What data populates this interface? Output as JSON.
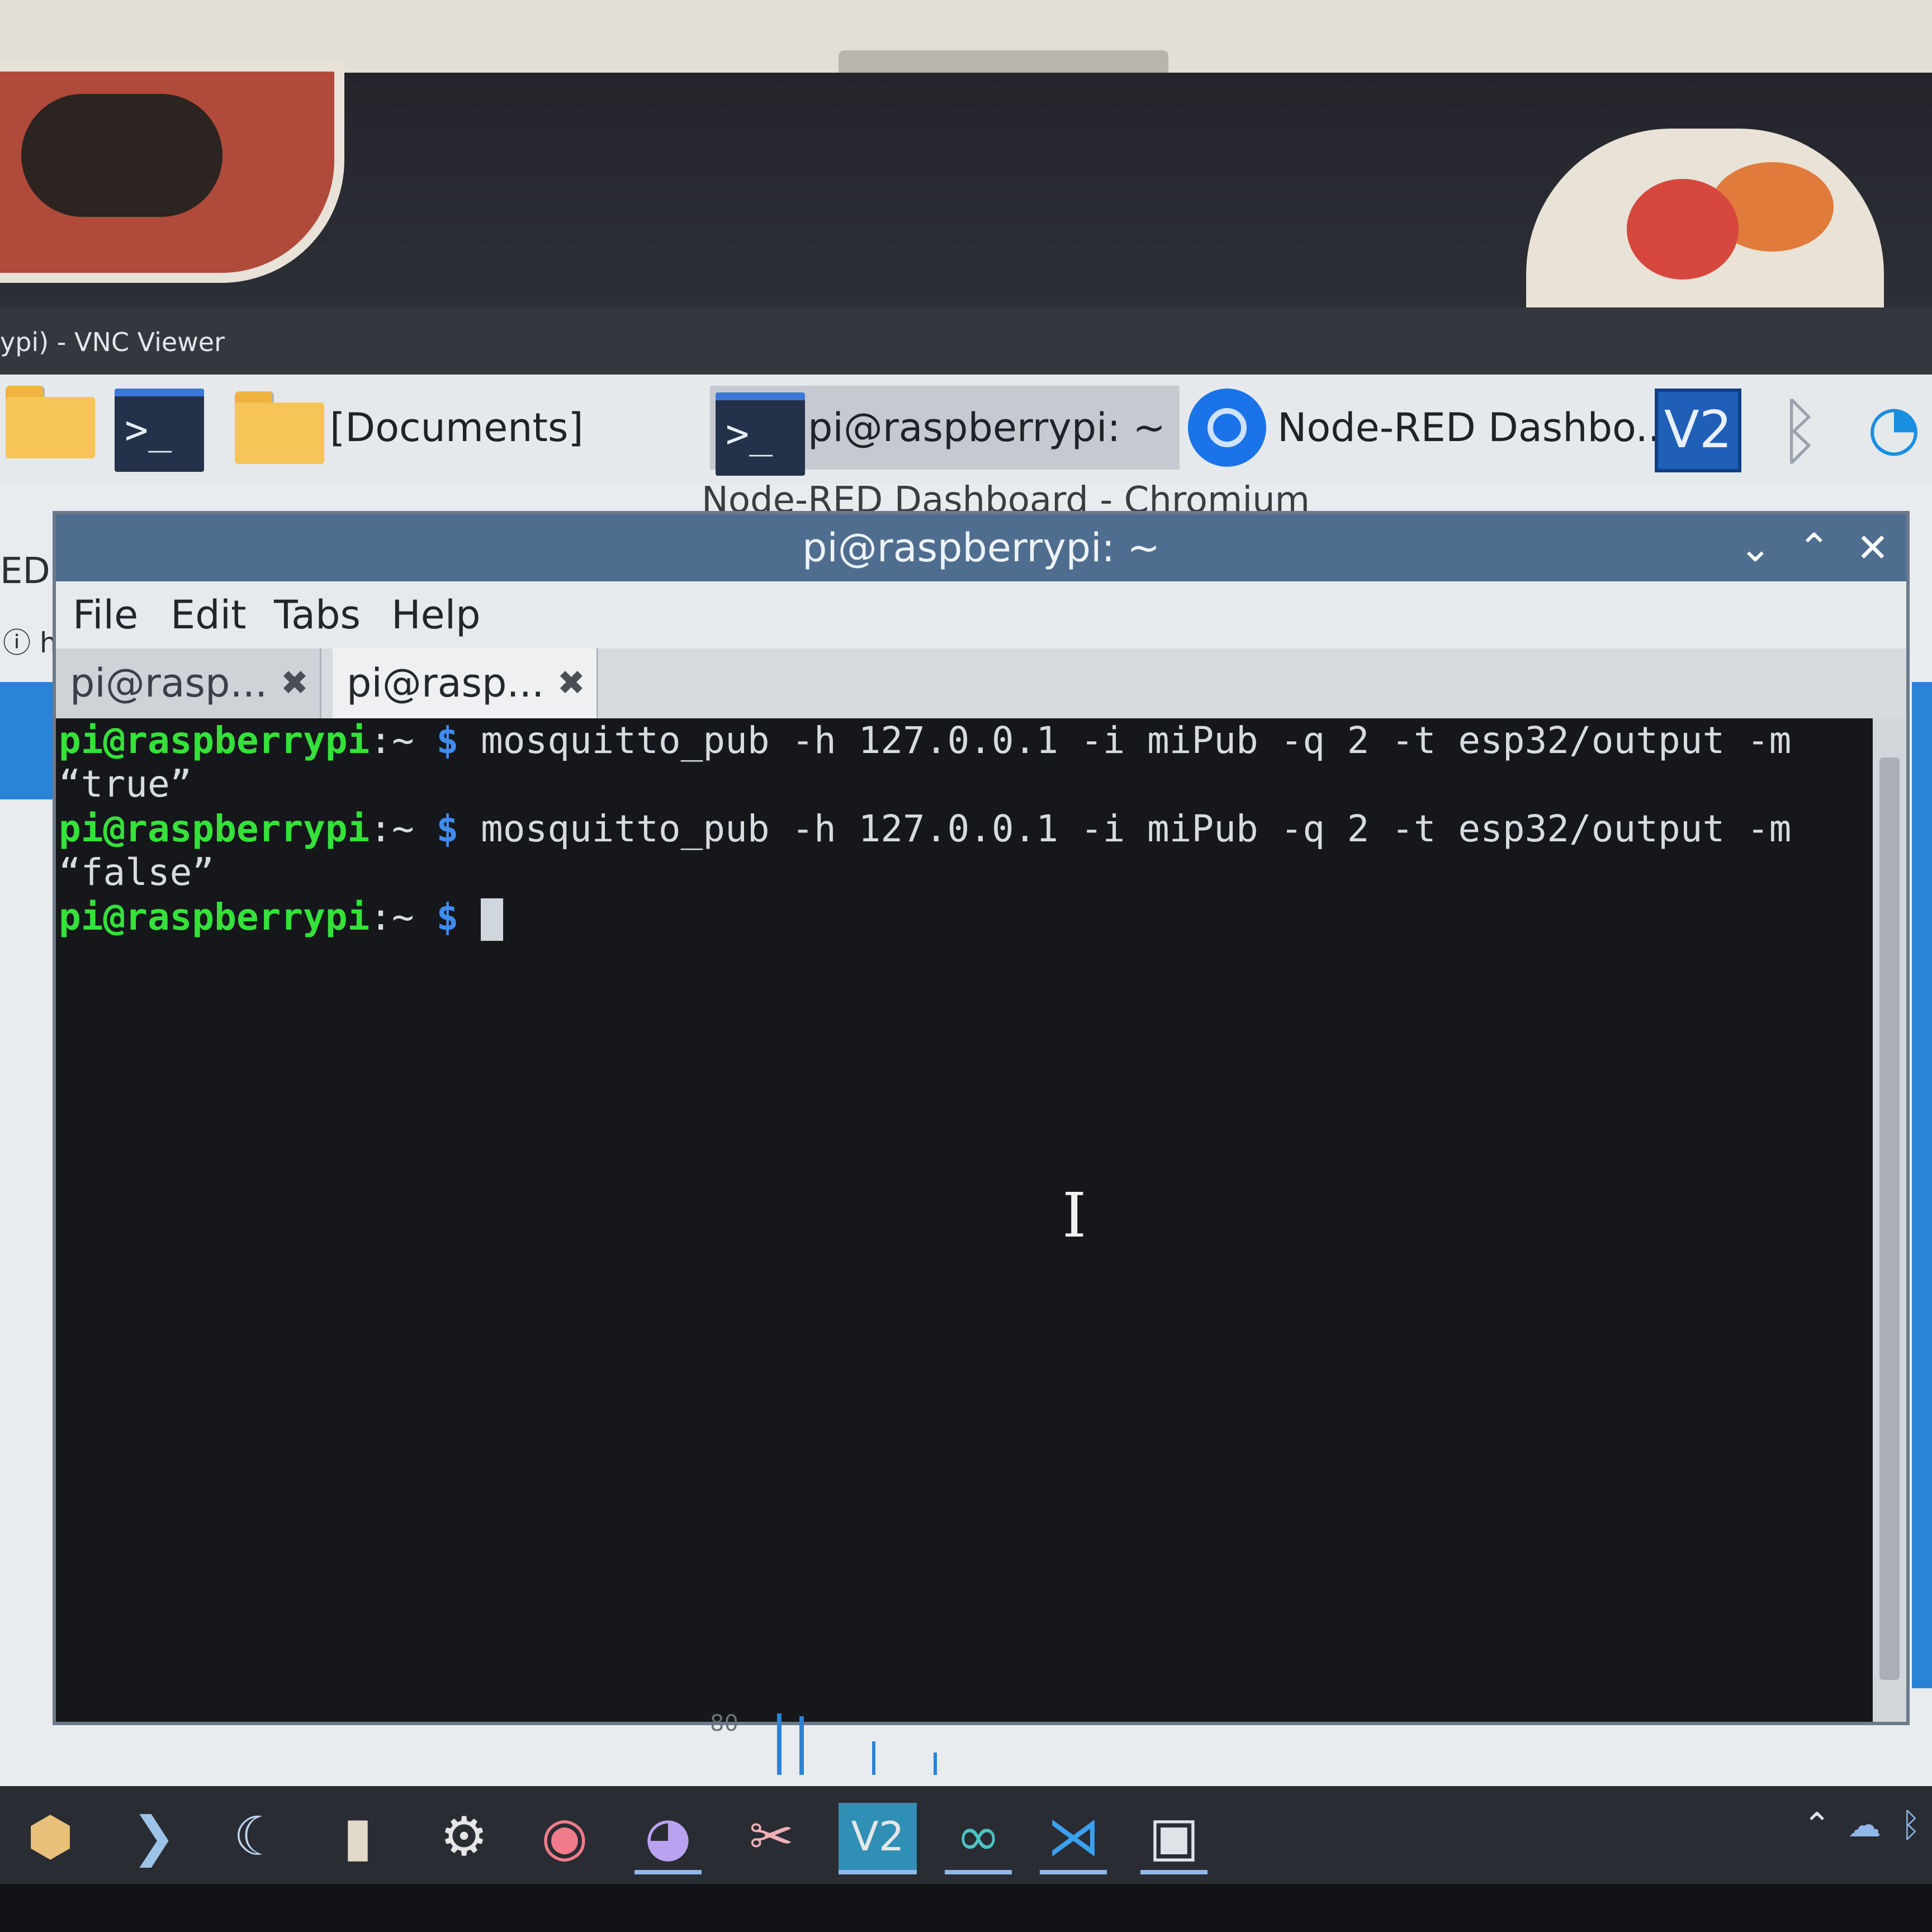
{
  "vnc": {
    "title": "ypi) - VNC Viewer"
  },
  "panel": {
    "documents_label": "[Documents]",
    "terminal_task_label": "pi@raspberrypi: ~",
    "browser_task_label": "Node-RED Dashbo...",
    "vnc_icon_label": "V2",
    "chromium_window_title": "Node-RED Dashboard - Chromium",
    "side_fragment_1": "ED",
    "side_fragment_2": "h"
  },
  "terminal": {
    "title": "pi@raspberrypi: ~",
    "controls": {
      "minimize": "⌄",
      "maximize": "⌃",
      "close": "✕"
    },
    "menu": [
      "File",
      "Edit",
      "Tabs",
      "Help"
    ],
    "tabs": [
      {
        "label": "pi@rasp...",
        "close": "✖"
      },
      {
        "label": "pi@rasp...",
        "close": "✖"
      }
    ],
    "prompt_user": "pi@raspberrypi",
    "prompt_path": ":~ ",
    "prompt_symbol": "$",
    "lines": [
      {
        "command": " mosquitto_pub -h 127.0.0.1 -i miPub -q 2 -t esp32/output -m",
        "continuation": "“true”"
      },
      {
        "command": " mosquitto_pub -h 127.0.0.1 -i miPub -q 2 -t esp32/output -m",
        "continuation": "“false”"
      }
    ]
  },
  "background_chart": {
    "tick_label": "80"
  },
  "icons": {
    "files": "folder-icon",
    "terminal": "terminal-icon",
    "browser": "chromium-icon",
    "vnc": "vnc-icon",
    "bluetooth": "bluetooth-icon",
    "wifi": "wifi-icon"
  },
  "colors": {
    "prompt_green": "#35e13a",
    "prompt_blue": "#3f8cf0",
    "title_bar": "#4f6e8f",
    "terminal_bg": "#15171b"
  }
}
